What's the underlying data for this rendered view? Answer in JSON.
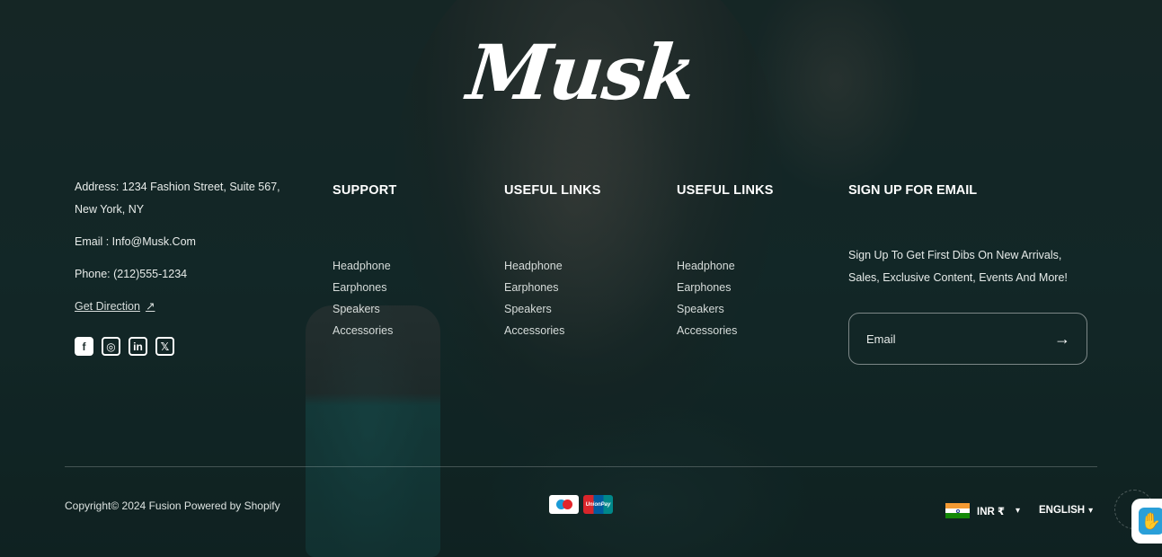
{
  "brand": {
    "logo_text": "Musk"
  },
  "contact": {
    "address": "Address: 1234 Fashion Street, Suite 567, New York, NY",
    "email": "Email : Info@Musk.Com",
    "phone": "Phone: (212)555-1234",
    "direction_link": "Get Direction",
    "social": [
      {
        "name": "facebook-icon",
        "glyph": "f"
      },
      {
        "name": "instagram-icon",
        "glyph": "◎"
      },
      {
        "name": "linkedin-icon",
        "glyph": "in"
      },
      {
        "name": "x-twitter-icon",
        "glyph": "𝕏"
      }
    ]
  },
  "columns": [
    {
      "title": "SUPPORT",
      "links": [
        "Headphone",
        "Earphones",
        "Speakers",
        "Accessories"
      ]
    },
    {
      "title": "USEFUL LINKS",
      "links": [
        "Headphone",
        "Earphones",
        "Speakers",
        "Accessories"
      ]
    },
    {
      "title": "USEFUL LINKS",
      "links": [
        "Headphone",
        "Earphones",
        "Speakers",
        "Accessories"
      ]
    }
  ],
  "signup": {
    "title": "SIGN UP FOR EMAIL",
    "description": "Sign Up To Get First Dibs On New Arrivals, Sales, Exclusive Content, Events And More!",
    "email_placeholder": "Email"
  },
  "footer": {
    "copyright": "Copyright© 2024 Fusion Powered by Shopify",
    "payment_methods": [
      "maestro",
      "unionpay"
    ],
    "unionpay_label": "UnionPay",
    "currency": "INR ₹",
    "language": "ENGLISH"
  }
}
